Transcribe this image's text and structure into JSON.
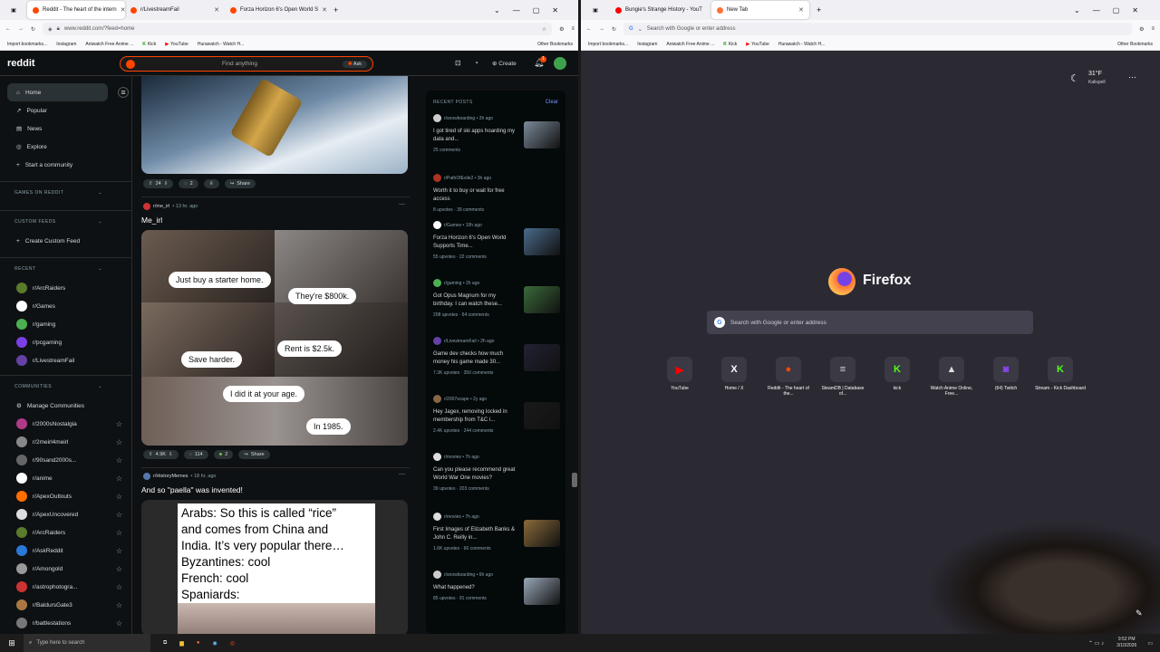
{
  "left_window": {
    "tabs": [
      {
        "label": "Reddit - The heart of the intern",
        "color": "#ff4500",
        "active": true
      },
      {
        "label": "r/LivestreamFail",
        "color": "#ff4500",
        "active": false
      },
      {
        "label": "Forza Horizon 6's Open World S",
        "color": "#ff4500",
        "active": false
      }
    ],
    "url": "www.reddit.com/?feed=home",
    "bookmarks": [
      "Import bookmarks...",
      "Instagram",
      "Aniwatch Free Anime ...",
      "Kick",
      "YouTube",
      "Hurawatch - Watch H..."
    ],
    "other_bookmarks": "Other Bookmarks"
  },
  "reddit": {
    "logo": "reddit",
    "search_placeholder": "Find anything",
    "ask": "Ask",
    "create": "Create",
    "notif_count": "1",
    "nav": [
      "Home",
      "Popular",
      "News",
      "Explore",
      "Start a community"
    ],
    "games_section": "GAMES ON REDDIT",
    "custom_section": "CUSTOM FEEDS",
    "create_feed": "Create Custom Feed",
    "recent_section": "RECENT",
    "recent": [
      {
        "name": "r/ArcRaiders",
        "color": "#5a7a2c"
      },
      {
        "name": "r/Games",
        "color": "#ffffff"
      },
      {
        "name": "r/gaming",
        "color": "#4caf50"
      },
      {
        "name": "r/pcgaming",
        "color": "#7b3fe4"
      },
      {
        "name": "r/LivestreamFail",
        "color": "#6441a5"
      }
    ],
    "communities_section": "COMMUNITIES",
    "manage": "Manage Communities",
    "communities": [
      {
        "name": "r/2000sNostalgia",
        "color": "#b03a8a"
      },
      {
        "name": "r/2meirl4meirl",
        "color": "#888888"
      },
      {
        "name": "r/90sand2000s...",
        "color": "#666666"
      },
      {
        "name": "r/anime",
        "color": "#ffffff"
      },
      {
        "name": "r/ApexOutlouts",
        "color": "#ff6f00"
      },
      {
        "name": "r/ApexUncovered",
        "color": "#dddddd"
      },
      {
        "name": "r/ArcRaiders",
        "color": "#5a7a2c"
      },
      {
        "name": "r/AskReddit",
        "color": "#2a78d8"
      },
      {
        "name": "r/Amongold",
        "color": "#999999"
      },
      {
        "name": "r/astrophotogra...",
        "color": "#cc3333"
      },
      {
        "name": "r/BaldursGate3",
        "color": "#aa7744"
      },
      {
        "name": "r/battlestations",
        "color": "#777777"
      }
    ],
    "post1": {
      "votes": "24",
      "comments": "2",
      "share": "Share"
    },
    "post2": {
      "sub": "r/me_irl",
      "time": "• 13 hr. ago",
      "title": "Me_irl",
      "bubbles": [
        "Just buy a starter home.",
        "They're $800k.",
        "Save harder.",
        "Rent is $2.5k.",
        "I did it at your age.",
        "In 1985."
      ],
      "votes": "4.9K",
      "comments": "114",
      "awards": "2",
      "share": "Share"
    },
    "post3": {
      "sub": "r/HistoryMemes",
      "time": "• 18 hr. ago",
      "title": "And so \"paella\" was invented!",
      "meme_lines": [
        "Arabs: So this is called “rice”",
        "and comes from China and",
        "India. It’s very popular there…",
        "Byzantines: cool",
        "French: cool",
        "Spaniards:"
      ]
    },
    "recent_posts": {
      "header": "RECENT POSTS",
      "clear": "Clear",
      "items": [
        {
          "sub": "r/snowboarding • 2h ago",
          "title": "I got tired of ski apps hoarding my data and...",
          "meta": "25 comments",
          "thumb": "#7a8a9a",
          "icon": "#cccccc"
        },
        {
          "sub": "r/PathOfExile2 • 3h ago",
          "title": "Worth it to buy or wait for free access",
          "meta": "8 upvotes · 39 comments",
          "thumb": "",
          "icon": "#aa3322"
        },
        {
          "sub": "r/Games • 10h ago",
          "title": "Forza Horizon 6's Open World Supports Time...",
          "meta": "55 upvotes · 22 comments",
          "thumb": "#4a6a8a",
          "icon": "#ffffff"
        },
        {
          "sub": "r/gaming • 2h ago",
          "title": "Got Opus Magnum for my birthday. I can watch these...",
          "meta": "208 upvotes · 64 comments",
          "thumb": "#3a6a3a",
          "icon": "#4caf50"
        },
        {
          "sub": "r/LivestreamFail • 2h ago",
          "title": "Game dev checks how much money his game made 30...",
          "meta": "7.3K upvotes · 350 comments",
          "thumb": "#222233",
          "icon": "#6441a5"
        },
        {
          "sub": "r/2007scape • 2y ago",
          "title": "Hey Jagex, removing locked in membership from T&C i...",
          "meta": "2.4K upvotes · 244 comments",
          "thumb": "#1a1a1a",
          "icon": "#886644"
        },
        {
          "sub": "r/movies • 7h ago",
          "title": "Can you please recommend great World War One movies?",
          "meta": "39 upvotes · 203 comments",
          "thumb": "",
          "icon": "#dddddd"
        },
        {
          "sub": "r/movies • 7h ago",
          "title": "First Images of Elizabeth Banks & John C. Reilly in...",
          "meta": "1.6K upvotes · 66 comments",
          "thumb": "#8a6a3a",
          "icon": "#dddddd"
        },
        {
          "sub": "r/snowboarding • 6h ago",
          "title": "What happened?",
          "meta": "85 upvotes · 91 comments",
          "thumb": "#9aa8b8",
          "icon": "#cccccc"
        }
      ]
    }
  },
  "right_window": {
    "tabs": [
      {
        "label": "Bungie's Strange History - YouT",
        "color": "#ff0000",
        "active": false
      },
      {
        "label": "New Tab",
        "color": "#ff7139",
        "active": true
      }
    ],
    "url_placeholder": "Search with Google or enter address",
    "bookmarks": [
      "Import bookmarks...",
      "Instagram",
      "Aniwatch Free Anime ...",
      "Kick",
      "YouTube",
      "Hurawatch - Watch H..."
    ],
    "other_bookmarks": "Other Bookmarks",
    "weather_temp": "31°F",
    "weather_city": "Kalispell",
    "brand": "Firefox",
    "search_placeholder": "Search with Google or enter address",
    "shortcuts": [
      {
        "label": "YouTube",
        "glyph": "▶",
        "color": "#ff0000"
      },
      {
        "label": "Home / X",
        "glyph": "X",
        "color": "#ffffff"
      },
      {
        "label": "Reddit - The heart of the...",
        "glyph": "●",
        "color": "#ff4500"
      },
      {
        "label": "SteamDB | Database of...",
        "glyph": "≡",
        "color": "#dddddd"
      },
      {
        "label": "kick",
        "glyph": "K",
        "color": "#53fc18"
      },
      {
        "label": "Watch Anime Online, Free...",
        "glyph": "▲",
        "color": "#dddddd"
      },
      {
        "label": "(64) Twitch",
        "glyph": "◙",
        "color": "#9146ff"
      },
      {
        "label": "Stream - Kick Dashboard",
        "glyph": "K",
        "color": "#53fc18"
      }
    ]
  },
  "taskbar": {
    "search_placeholder": "Type here to search",
    "time": "9:52 PM",
    "date": "3/10/2026"
  }
}
